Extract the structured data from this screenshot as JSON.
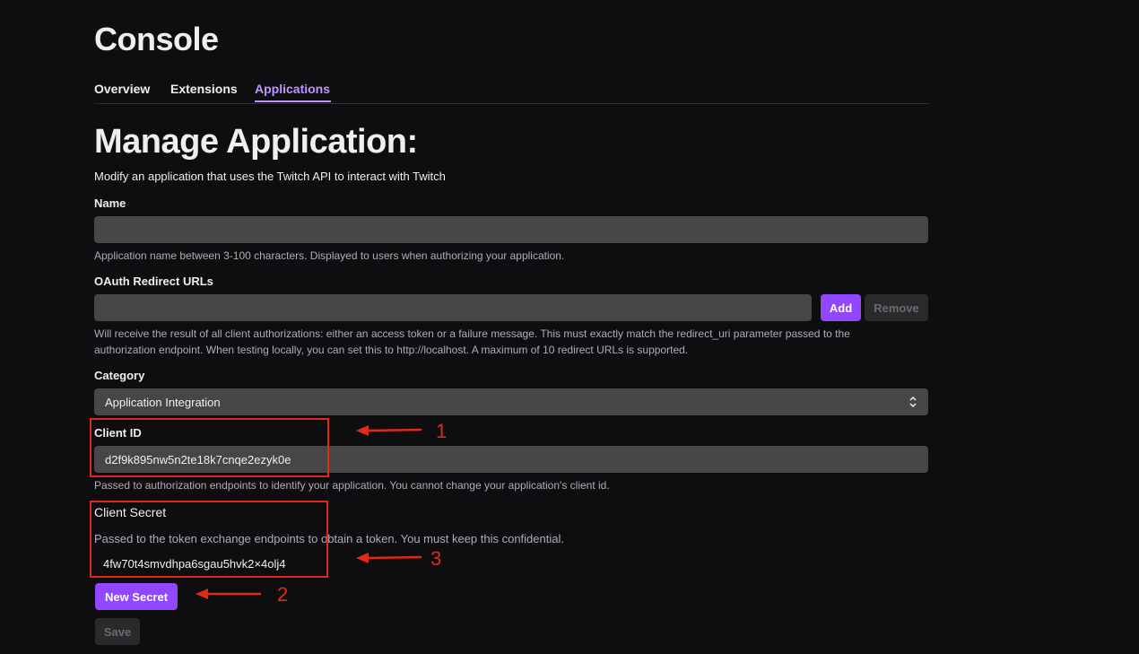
{
  "header": {
    "title": "Console"
  },
  "tabs": [
    {
      "label": "Overview",
      "active": false
    },
    {
      "label": "Extensions",
      "active": false
    },
    {
      "label": "Applications",
      "active": true
    }
  ],
  "main": {
    "title": "Manage Application:",
    "subtitle": "Modify an application that uses the Twitch API to interact with Twitch"
  },
  "fields": {
    "name": {
      "label": "Name",
      "value": "",
      "help": "Application name between 3-100 characters. Displayed to users when authorizing your application."
    },
    "redirect": {
      "label": "OAuth Redirect URLs",
      "value": "",
      "add_label": "Add",
      "remove_label": "Remove",
      "help_line1": "Will receive the result of all client authorizations: either an access token or a failure message. This must exactly match the redirect_uri parameter passed to the",
      "help_line2": "authorization endpoint. When testing locally, you can set this to http://localhost. A maximum of 10 redirect URLs is supported."
    },
    "category": {
      "label": "Category",
      "selected": "Application Integration"
    },
    "client_id": {
      "label": "Client ID",
      "value": "d2f9k895nw5n2te18k7cnqe2ezyk0e",
      "help": "Passed to authorization endpoints to identify your application. You cannot change your application's client id."
    },
    "client_secret": {
      "label": "Client Secret",
      "help": "Passed to the token exchange endpoints to obtain a token. You must keep this confidential.",
      "value": "4fw70t4smvdhpa6sgau5hvk2×4olj4",
      "new_secret_label": "New Secret"
    }
  },
  "save_label": "Save",
  "annotations": {
    "color": "#e02a19",
    "labels": [
      "1",
      "2",
      "3"
    ]
  },
  "colors": {
    "background": "#0e0e10",
    "accent": "#9147ff",
    "accent_text": "#bf94ff",
    "input_bg": "#464649"
  }
}
